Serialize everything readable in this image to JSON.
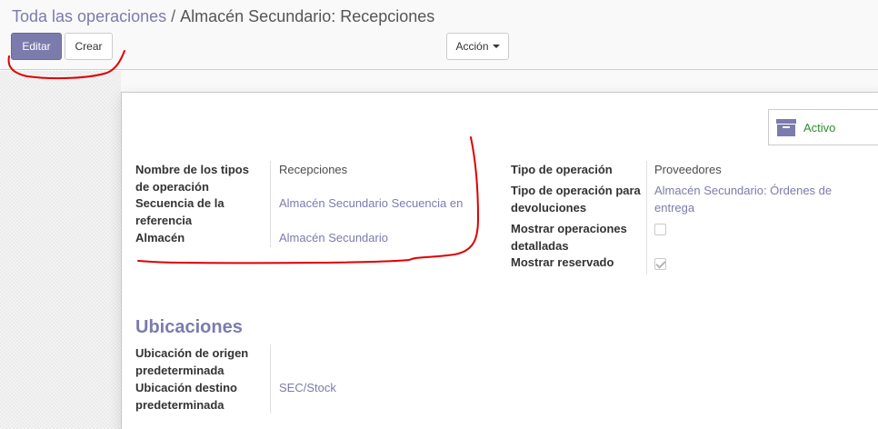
{
  "breadcrumb": {
    "parent": "Toda las operaciones",
    "separator": "/",
    "current": "Almacén Secundario: Recepciones"
  },
  "toolbar": {
    "edit_label": "Editar",
    "create_label": "Crear",
    "action_label": "Acción"
  },
  "status_button": {
    "icon": "archive-icon",
    "label": "Activo"
  },
  "left_fields": [
    {
      "label": "Nombre de los tipos de operación",
      "value": "Recepciones",
      "link": false
    },
    {
      "label": "Secuencia de la referencia",
      "value": "Almacén Secundario Secuencia en",
      "link": true
    },
    {
      "label": "Almacén",
      "value": "Almacén Secundario",
      "link": true
    }
  ],
  "right_fields": {
    "tipo_operacion": {
      "label": "Tipo de operación",
      "value": "Proveedores"
    },
    "tipo_devoluciones": {
      "label": "Tipo de operación para devoluciones",
      "value": "Almacén Secundario: Órdenes de entrega"
    },
    "mostrar_detalladas": {
      "label": "Mostrar operaciones detalladas",
      "checked": false
    },
    "mostrar_reservado": {
      "label": "Mostrar reservado",
      "checked": true
    }
  },
  "locations": {
    "title": "Ubicaciones",
    "origen": {
      "label": "Ubicación de origen predeterminada",
      "value": ""
    },
    "destino": {
      "label": "Ubicación destino predeterminada",
      "value": "SEC/Stock"
    }
  },
  "colors": {
    "accent": "#7c7bad",
    "active_green": "#2f8f2f",
    "annotation_red": "#e00000"
  }
}
